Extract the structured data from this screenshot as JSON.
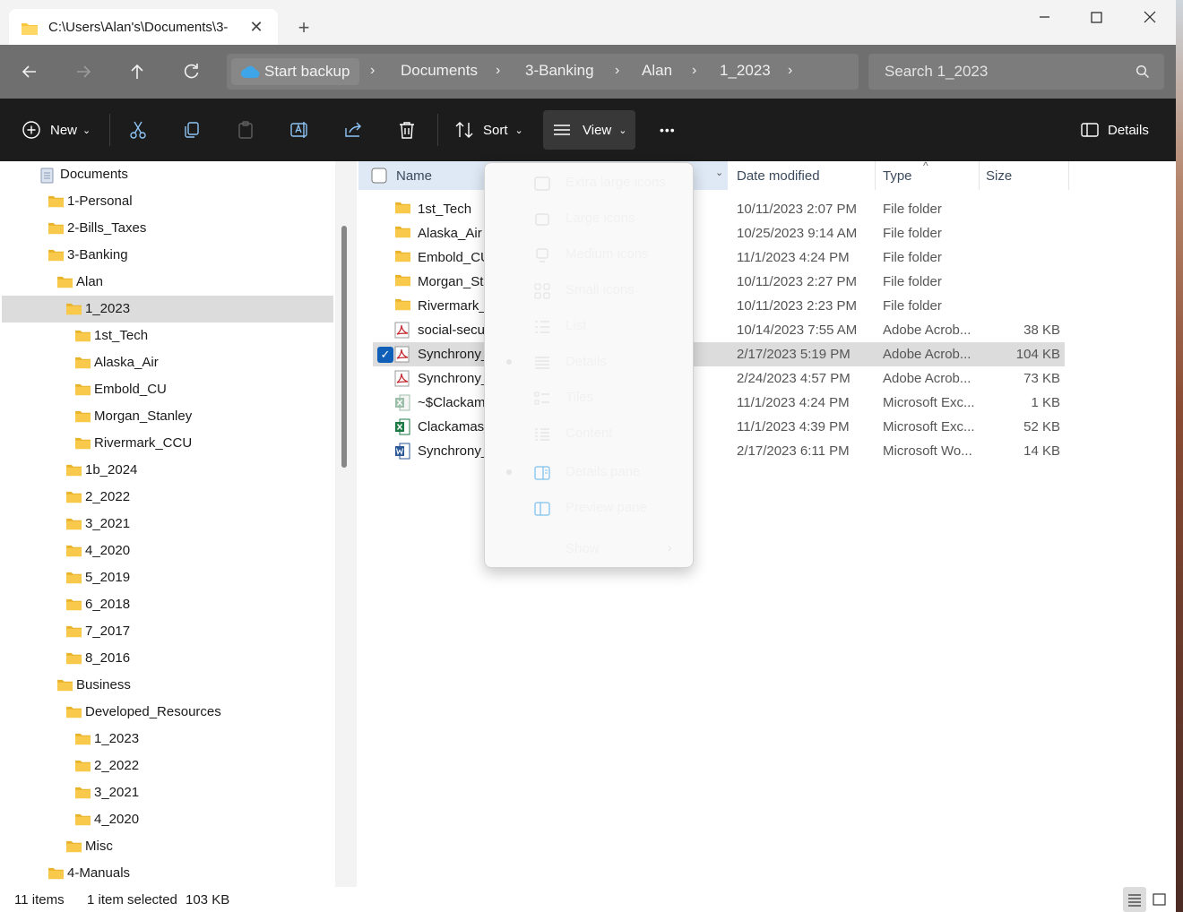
{
  "tab": {
    "title": "C:\\Users\\Alan's\\Documents\\3-"
  },
  "address": {
    "backup_label": "Start backup",
    "crumbs": [
      "Documents",
      "3-Banking",
      "Alan",
      "1_2023"
    ]
  },
  "search": {
    "placeholder": "Search 1_2023"
  },
  "toolbar": {
    "new_label": "New",
    "sort_label": "Sort",
    "view_label": "View",
    "more_label": "•••",
    "details_label": "Details"
  },
  "sidebar": {
    "items": [
      {
        "label": "Documents",
        "icon": "document-icon"
      },
      {
        "label": "1-Personal",
        "icon": "folder-icon"
      },
      {
        "label": "2-Bills_Taxes",
        "icon": "folder-icon"
      },
      {
        "label": "3-Banking",
        "icon": "folder-icon"
      },
      {
        "label": "Alan",
        "icon": "folder-icon"
      },
      {
        "label": "1_2023",
        "icon": "folder-icon",
        "selected": true
      },
      {
        "label": "1st_Tech",
        "icon": "folder-icon"
      },
      {
        "label": "Alaska_Air",
        "icon": "folder-icon"
      },
      {
        "label": "Embold_CU",
        "icon": "folder-icon"
      },
      {
        "label": "Morgan_Stanley",
        "icon": "folder-icon"
      },
      {
        "label": "Rivermark_CCU",
        "icon": "folder-icon"
      },
      {
        "label": "1b_2024",
        "icon": "folder-icon"
      },
      {
        "label": "2_2022",
        "icon": "folder-icon"
      },
      {
        "label": "3_2021",
        "icon": "folder-icon"
      },
      {
        "label": "4_2020",
        "icon": "folder-icon"
      },
      {
        "label": "5_2019",
        "icon": "folder-icon"
      },
      {
        "label": "6_2018",
        "icon": "folder-icon"
      },
      {
        "label": "7_2017",
        "icon": "folder-icon"
      },
      {
        "label": "8_2016",
        "icon": "folder-icon"
      },
      {
        "label": "Business",
        "icon": "folder-icon"
      },
      {
        "label": "Developed_Resources",
        "icon": "folder-icon"
      },
      {
        "label": "1_2023",
        "icon": "folder-icon"
      },
      {
        "label": "2_2022",
        "icon": "folder-icon"
      },
      {
        "label": "3_2021",
        "icon": "folder-icon"
      },
      {
        "label": "4_2020",
        "icon": "folder-icon"
      },
      {
        "label": "Misc",
        "icon": "folder-icon"
      },
      {
        "label": "4-Manuals",
        "icon": "folder-icon"
      }
    ]
  },
  "columns": {
    "name": "Name",
    "date": "Date modified",
    "type": "Type",
    "size": "Size"
  },
  "files": [
    {
      "name": "1st_Tech",
      "date": "10/11/2023 2:07 PM",
      "type": "File folder",
      "size": "",
      "icon": "folder-icon"
    },
    {
      "name": "Alaska_Air",
      "date": "10/25/2023 9:14 AM",
      "type": "File folder",
      "size": "",
      "icon": "folder-icon"
    },
    {
      "name": "Embold_CU",
      "date": "11/1/2023 4:24 PM",
      "type": "File folder",
      "size": "",
      "icon": "folder-icon"
    },
    {
      "name": "Morgan_Stanley",
      "date": "10/11/2023 2:27 PM",
      "type": "File folder",
      "size": "",
      "icon": "folder-icon"
    },
    {
      "name": "Rivermark_CCU",
      "date": "10/11/2023 2:23 PM",
      "type": "File folder",
      "size": "",
      "icon": "folder-icon"
    },
    {
      "name": "social-security",
      "date": "10/14/2023 7:55 AM",
      "type": "Adobe Acrob...",
      "size": "38 KB",
      "icon": "pdf-icon"
    },
    {
      "name": "Synchrony_",
      "date": "2/17/2023 5:19 PM",
      "type": "Adobe Acrob...",
      "size": "104 KB",
      "icon": "pdf-icon",
      "selected": true
    },
    {
      "name": "Synchrony_",
      "date": "2/24/2023 4:57 PM",
      "type": "Adobe Acrob...",
      "size": "73 KB",
      "icon": "pdf-icon"
    },
    {
      "name": "~$Clackamas",
      "date": "11/1/2023 4:24 PM",
      "type": "Microsoft Exc...",
      "size": "1 KB",
      "icon": "excel-temp-icon"
    },
    {
      "name": "Clackamas_",
      "date": "11/1/2023 4:39 PM",
      "type": "Microsoft Exc...",
      "size": "52 KB",
      "icon": "excel-icon"
    },
    {
      "name": "Synchrony_",
      "date": "2/17/2023 6:11 PM",
      "type": "Microsoft Wo...",
      "size": "14 KB",
      "icon": "word-icon"
    }
  ],
  "view_menu": {
    "items": [
      {
        "label": "Extra large icons",
        "icon": "extra-large-icons-icon"
      },
      {
        "label": "Large icons",
        "icon": "large-icons-icon"
      },
      {
        "label": "Medium icons",
        "icon": "medium-icons-icon"
      },
      {
        "label": "Small icons",
        "icon": "small-icons-icon"
      },
      {
        "label": "List",
        "icon": "list-icon"
      },
      {
        "label": "Details",
        "icon": "details-icon",
        "checked": true
      },
      {
        "label": "Tiles",
        "icon": "tiles-icon"
      },
      {
        "label": "Content",
        "icon": "content-icon"
      },
      {
        "label": "Details pane",
        "icon": "details-pane-icon",
        "checked": true
      },
      {
        "label": "Preview pane",
        "icon": "preview-pane-icon"
      },
      {
        "label": "Show",
        "icon": "",
        "submenu": true
      }
    ]
  },
  "status": {
    "items": "11 items",
    "selected": "1 item selected",
    "size": "103 KB"
  },
  "colors": {
    "accent": "#0f5fb8",
    "folder": "#f8c73e",
    "pdf": "#c4262e",
    "excel": "#1d7a45",
    "word": "#2b5797"
  }
}
